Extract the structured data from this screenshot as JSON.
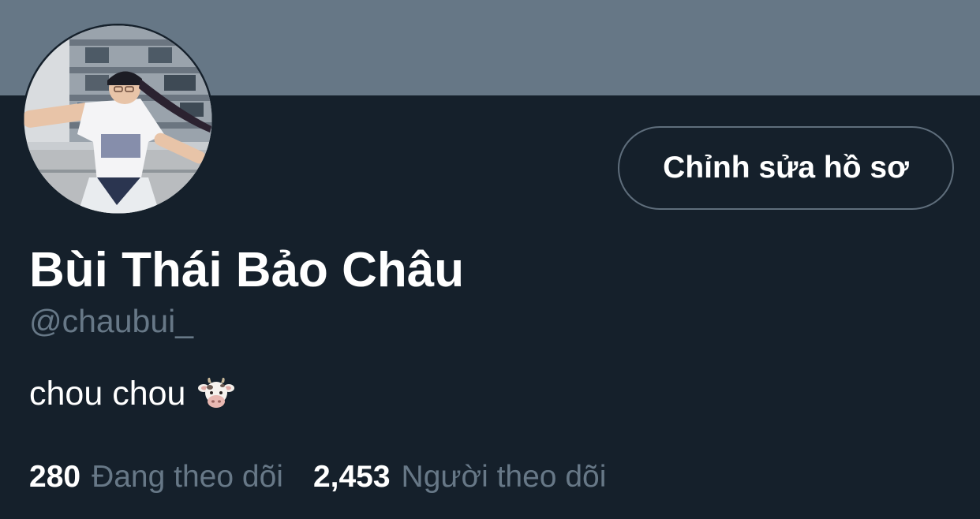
{
  "profile": {
    "display_name": "Bùi Thái Bảo Châu",
    "handle": "@chaubui_",
    "bio_text": "chou chou",
    "bio_emoji": "cow-face-emoji",
    "edit_button_label": "Chỉnh sửa hồ sơ"
  },
  "stats": {
    "following_count": "280",
    "following_label": "Đang theo dõi",
    "followers_count": "2,453",
    "followers_label": "Người theo dõi"
  },
  "colors": {
    "background": "#15202b",
    "banner": "#667786",
    "secondary_text": "#677887",
    "button_border": "#5f6e7c"
  }
}
